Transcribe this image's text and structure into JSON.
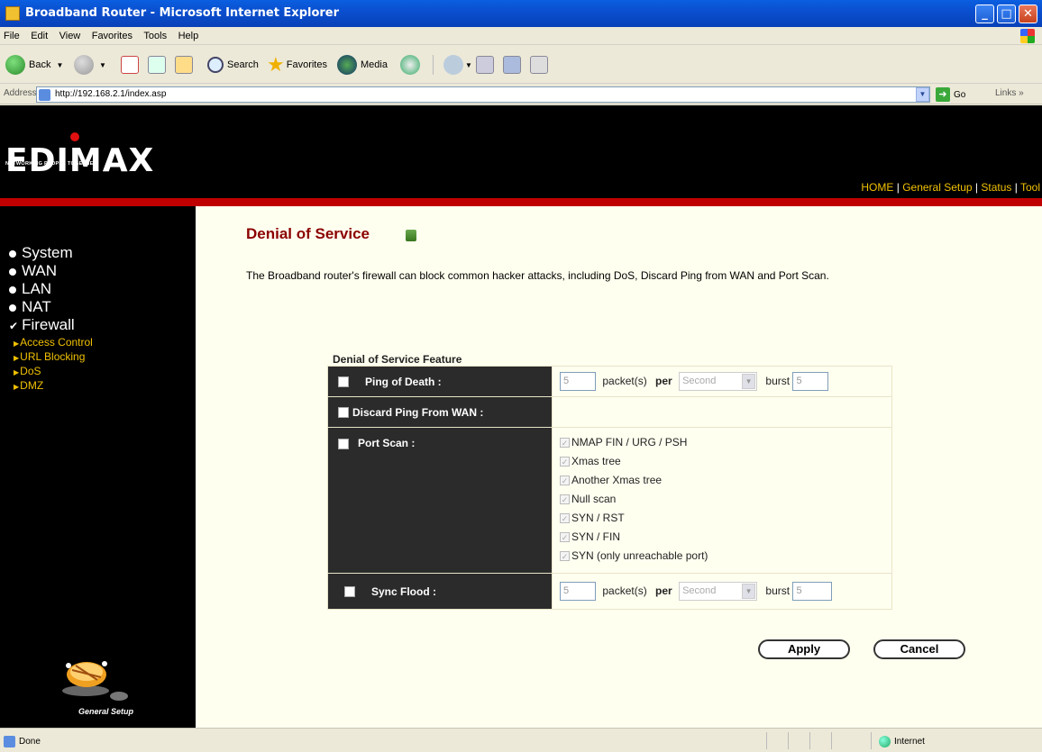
{
  "window": {
    "title": "Broadband Router - Microsoft Internet Explorer",
    "controls": {
      "minimize": "_",
      "maximize": "□",
      "close": "✕"
    }
  },
  "menu": [
    "File",
    "Edit",
    "View",
    "Favorites",
    "Tools",
    "Help"
  ],
  "toolbar": {
    "back": "Back",
    "search": "Search",
    "favorites": "Favorites",
    "media": "Media"
  },
  "address": {
    "label": "Address",
    "url": "http://192.168.2.1/index.asp",
    "go": "Go",
    "links": "Links »"
  },
  "banner": {
    "logo": "EDIMAX",
    "tagline": "NETWORKING PEOPLE TOGETHER",
    "nav": {
      "home": "HOME",
      "general": "General Setup",
      "status": "Status",
      "tool": "Tool",
      "sep": " | "
    }
  },
  "sidebar": {
    "items": [
      "System",
      "WAN",
      "LAN",
      "NAT",
      "Firewall"
    ],
    "subitems": [
      "Access Control",
      "URL Blocking",
      "DoS",
      "DMZ"
    ],
    "footer": "General Setup"
  },
  "main": {
    "title": "Denial of Service",
    "description": "The Broadband router's firewall can block common hacker attacks, including DoS, Discard Ping from WAN and Port Scan.",
    "section_title": "Denial of Service Feature",
    "rows": {
      "ping_of_death": {
        "label": "Ping of Death :",
        "packets": "5",
        "packets_label": "packet(s)",
        "per_label": "per",
        "unit": "Second",
        "burst_label": "burst",
        "burst": "5"
      },
      "discard_ping": {
        "label": "Discard Ping From WAN :"
      },
      "port_scan": {
        "label": "Port Scan :",
        "options": [
          "NMAP FIN / URG / PSH",
          "Xmas tree",
          "Another Xmas tree",
          "Null scan",
          "SYN / RST",
          "SYN / FIN",
          "SYN (only unreachable port)"
        ]
      },
      "sync_flood": {
        "label": "Sync Flood :",
        "packets": "5",
        "packets_label": "packet(s)",
        "per_label": "per",
        "unit": "Second",
        "burst_label": "burst",
        "burst": "5"
      }
    },
    "buttons": {
      "apply": "Apply",
      "cancel": "Cancel"
    }
  },
  "status": {
    "text": "Done",
    "zone": "Internet"
  },
  "colors": {
    "title_red": "#8b0000",
    "nav_yellow": "#f0c000",
    "banner_black": "#000000",
    "accent_red": "#c00000",
    "content_bg": "#ffffef"
  }
}
